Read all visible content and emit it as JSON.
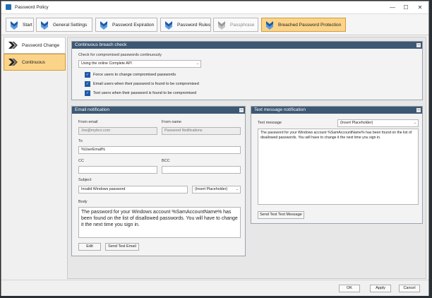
{
  "window": {
    "title": "Password Policy"
  },
  "toolbar": {
    "tabs": [
      {
        "label": "Start"
      },
      {
        "label": "General Settings"
      },
      {
        "label": "Password Expiration"
      },
      {
        "label": "Password Rules"
      },
      {
        "label": "Passphrase"
      },
      {
        "label": "Breached Password Protection"
      }
    ]
  },
  "sidebar": {
    "items": [
      {
        "label": "Password Change"
      },
      {
        "label": "Continuous"
      }
    ]
  },
  "breach": {
    "header": "Continuous breach check",
    "check_label": "Check for compromised passwords continuously",
    "method_value": "Using the online Complete API",
    "options": [
      {
        "label": "Force users to change compromised passwords"
      },
      {
        "label": "Email users when their password is found to be compromised"
      },
      {
        "label": "Text users when their password is found to be compromised"
      }
    ]
  },
  "email": {
    "header": "Email notification",
    "from_email_label": "From email",
    "from_email_value": "Joe@mybco.com",
    "from_name_label": "From name",
    "from_name_value": "Password Notifications",
    "to_label": "To",
    "to_value": "%UserEmail%",
    "cc_label": "CC",
    "cc_value": "",
    "bcc_label": "BCC",
    "bcc_value": "",
    "subject_label": "Subject",
    "subject_value": "Invalid Windows password",
    "placeholder_select": "(Insert Placeholder)",
    "body_label": "Body",
    "body_value": "The password for your Windows account %SamAccountName% has been found on the list of disallowed passwords. You will have to change it the next time you sign in.",
    "edit_button": "Edit",
    "send_test_button": "Send Test Email"
  },
  "sms": {
    "header": "Text message notification",
    "message_label": "Text message",
    "placeholder_select": "(Insert Placeholder)",
    "message_value": "The password for your Windows account %SamAccountName% has been found on the list of disallowed passwords. You will have to change it the next time you sign in.",
    "send_test_button": "Send Test Text Message"
  },
  "footer": {
    "ok": "OK",
    "apply": "Apply",
    "cancel": "Cancel"
  }
}
